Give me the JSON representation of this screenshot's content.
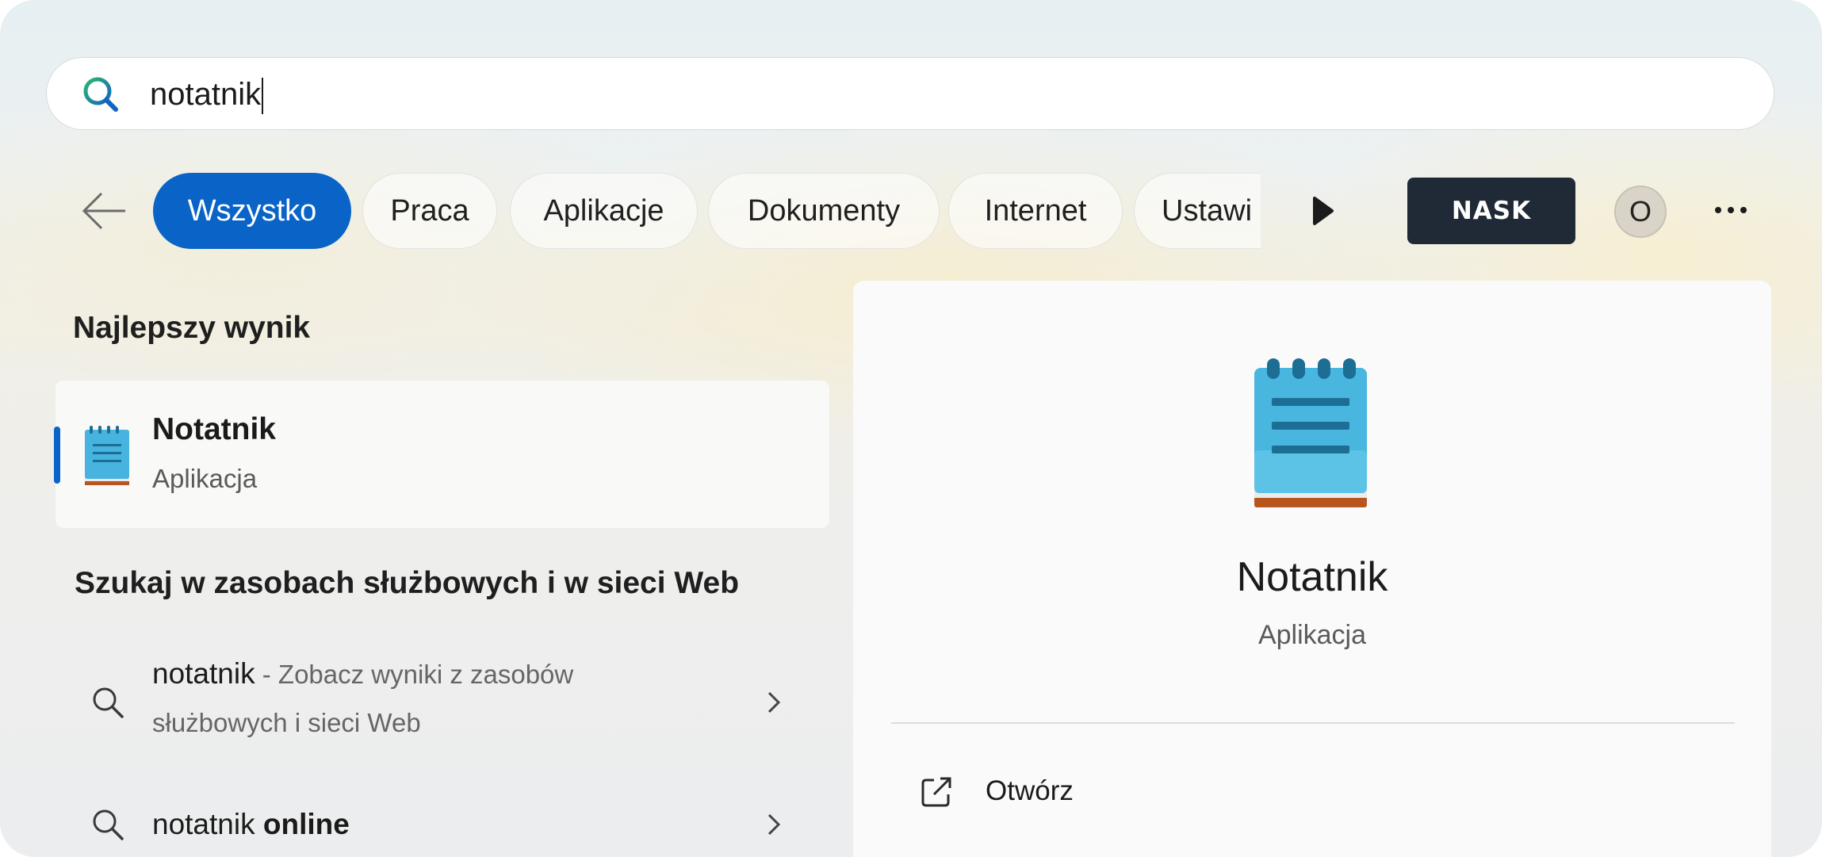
{
  "search": {
    "query": "notatnik"
  },
  "filters": {
    "tabs": [
      {
        "label": "Wszystko",
        "active": true
      },
      {
        "label": "Praca",
        "active": false
      },
      {
        "label": "Aplikacje",
        "active": false
      },
      {
        "label": "Dokumenty",
        "active": false
      },
      {
        "label": "Internet",
        "active": false
      },
      {
        "label": "Ustawi",
        "active": false
      }
    ]
  },
  "header": {
    "org_label": "NASK",
    "avatar_initial": "O"
  },
  "best_match": {
    "section_title": "Najlepszy wynik",
    "title": "Notatnik",
    "subtitle": "Aplikacja",
    "icon": "notepad-icon"
  },
  "web_search": {
    "section_title": "Szukaj w zasobach służbowych i w sieci Web",
    "results": [
      {
        "query": "notatnik",
        "suffix_line1": " - Zobacz wyniki z zasobów",
        "suffix_line2": "służbowych i sieci Web"
      },
      {
        "query_plain": "notatnik ",
        "query_bold": "online"
      }
    ]
  },
  "detail": {
    "title": "Notatnik",
    "subtitle": "Aplikacja",
    "actions": [
      {
        "label": "Otwórz",
        "icon": "open-external-icon"
      }
    ]
  },
  "colors": {
    "accent": "#0a64c8",
    "org_button": "#1f2a36"
  }
}
